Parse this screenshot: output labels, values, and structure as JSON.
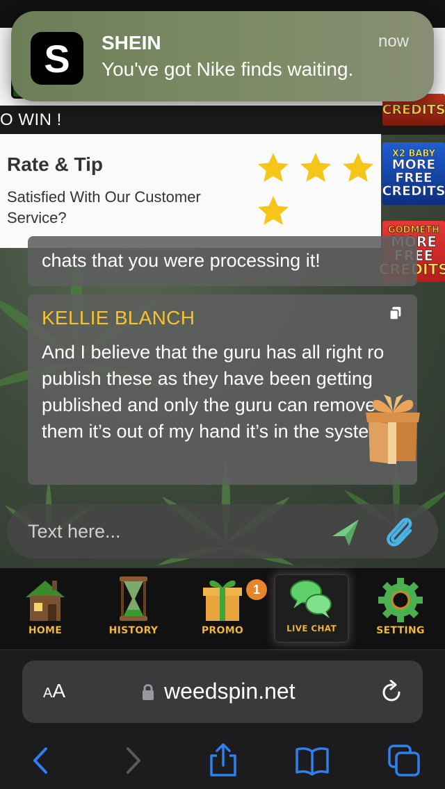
{
  "notification": {
    "app_icon_letter": "S",
    "app_name": "SHEIN",
    "message": "You've got Nike finds waiting.",
    "time": "now"
  },
  "page": {
    "win_banner": "O WIN !",
    "rate_panel": {
      "title": "Rate & Tip",
      "description": "Satisfied With Our Customer Service?",
      "star_count": 4,
      "star_color": "#f5c518"
    },
    "side_promos": [
      {
        "lines": [
          "CREDITS"
        ]
      },
      {
        "lines": [
          "X2 BABY",
          "MORE",
          "FREE",
          "CREDITS"
        ]
      },
      {
        "lines": [
          "GODMETH",
          "MORE",
          "FREE",
          "CREDITS"
        ]
      }
    ],
    "chat": {
      "previous_message": "chats that you were processing it!",
      "messages": [
        {
          "sender": "KELLIE BLANCH",
          "text": "And I believe that the guru has all right ro publish these as they have been getting published and only the guru can remove them it’s out of my hand it’s in the system"
        }
      ]
    },
    "composer": {
      "placeholder": "Text here...",
      "send_icon": "send-icon",
      "attach_icon": "paperclip-icon"
    },
    "nav": {
      "items": [
        {
          "label": "HOME",
          "icon": "house-icon"
        },
        {
          "label": "HISTORY",
          "icon": "hourglass-icon"
        },
        {
          "label": "PROMO",
          "icon": "gift-icon",
          "badge": "1"
        },
        {
          "label": "LIVE CHAT",
          "icon": "chat-bubbles-icon",
          "active": true
        },
        {
          "label": "SETTING",
          "icon": "gear-icon"
        }
      ],
      "label_color": "#f3c04b",
      "badge_color": "#e8842a"
    }
  },
  "browser": {
    "aa_label_small": "A",
    "aa_label_large": "A",
    "url": "weedspin.net",
    "toolbar_icons": [
      "back-icon",
      "forward-icon",
      "share-icon",
      "bookmarks-icon",
      "tabs-icon"
    ],
    "accent": "#2f80ed"
  },
  "colors": {
    "sender_name": "#f4c430",
    "bubble_bg": "#5f5f5f"
  }
}
